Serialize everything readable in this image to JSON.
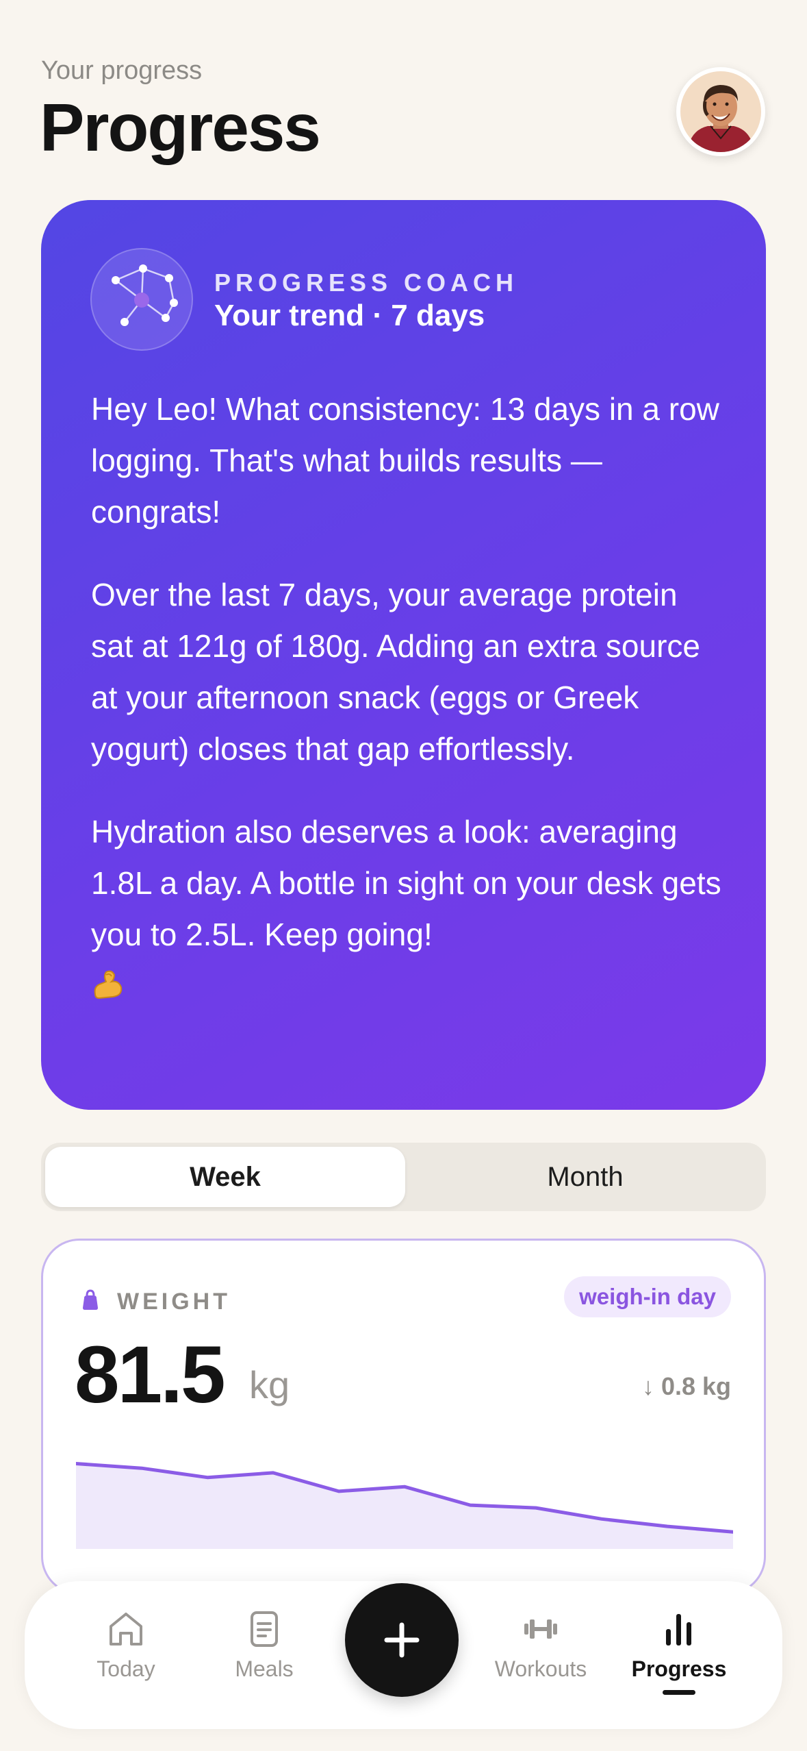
{
  "header": {
    "subtitle": "Your progress",
    "title": "Progress"
  },
  "coach": {
    "label": "PROGRESS COACH",
    "subtitle": "Your trend · 7 days",
    "paragraphs": [
      "Hey Leo! What consistency: 13 days in a row logging. That's what builds results — congrats!",
      "Over the last 7 days, your average protein sat at 121g of 180g. Adding an extra source at your afternoon snack (eggs or Greek yogurt) closes that gap effortlessly.",
      "Hydration also deserves a look: averaging 1.8L a day. A bottle in sight on your desk gets you to 2.5L. Keep going!"
    ],
    "emoji_icon": "flexed-biceps-icon"
  },
  "range_toggle": {
    "options": [
      "Week",
      "Month"
    ],
    "selected": "Week"
  },
  "weight_card": {
    "label": "WEIGHT",
    "badge": "weigh-in day",
    "value": "81.5",
    "unit": "kg",
    "delta": "↓ 0.8 kg",
    "accent_color": "#8b5ce6",
    "trend": [
      82.3,
      82.25,
      82.15,
      82.2,
      82.0,
      82.05,
      81.85,
      81.82,
      81.7,
      81.62,
      81.56
    ]
  },
  "nav": {
    "items": [
      {
        "label": "Today",
        "icon": "home-icon"
      },
      {
        "label": "Meals",
        "icon": "document-icon"
      },
      {
        "label": "Workouts",
        "icon": "dumbbell-icon"
      },
      {
        "label": "Progress",
        "icon": "bar-chart-icon"
      }
    ],
    "active": "Progress",
    "fab_icon": "plus-icon"
  }
}
